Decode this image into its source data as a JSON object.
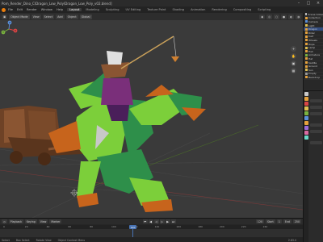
{
  "window": {
    "title": "Pom_Render_Dino_C\\Dragon_Low_Poly\\Dragon_Low_Poly_v02.blend]"
  },
  "menubar": {
    "items": [
      "File",
      "Edit",
      "Render",
      "Window",
      "Help"
    ],
    "workspaces": [
      "Layout",
      "Modeling",
      "Sculpting",
      "UV Editing",
      "Texture Paint",
      "Shading",
      "Animation",
      "Rendering",
      "Compositing",
      "Scripting"
    ],
    "active_workspace": "Layout"
  },
  "viewport_header": {
    "mode": "Object Mode",
    "view": "View",
    "select": "Select",
    "add": "Add",
    "object": "Object",
    "transform": "Global"
  },
  "viewport": {
    "gizmo_axes": [
      "X",
      "Y",
      "Z"
    ],
    "colors": {
      "background": "#3a3a3a",
      "dragon_green": "#7ccf3a",
      "dragon_dark_green": "#2e8f4a",
      "dragon_orange": "#c7641c",
      "cart_brown": "#7a4a2a",
      "rider_purple": "#7a2f7a",
      "grid_line": "#474747"
    }
  },
  "timeline": {
    "playback": "Playback",
    "keying": "Keying",
    "view": "View",
    "marker": "Marker",
    "current_frame": "120",
    "start_label": "Start",
    "start": "1",
    "end_label": "End",
    "end": "250",
    "ruler": [
      "0",
      "20",
      "40",
      "60",
      "80",
      "100",
      "120",
      "140",
      "160",
      "180",
      "200",
      "220",
      "240"
    ]
  },
  "statusbar": {
    "select": "Select",
    "box_select": "Box Select",
    "rotate_view": "Rotate View",
    "context_menu": "Object Context Menu",
    "version": "2.83.0"
  },
  "outliner": {
    "rows": [
      "Scene Collection",
      "Collection",
      "Camera",
      "Light",
      "Dragon",
      "Rider",
      "Cart",
      "Wheels",
      "Rope",
      "Lamp",
      "Fish",
      "Armature",
      "Hat",
      "Saddle",
      "Ground",
      "Sun",
      "Empty",
      "Backdrop"
    ]
  }
}
